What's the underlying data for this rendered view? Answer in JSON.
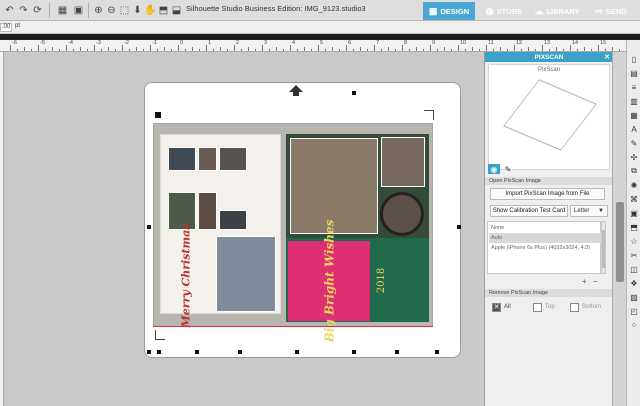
{
  "app": {
    "title": "Silhouette Studio Business Edition: IMG_9123.studio3"
  },
  "tabs": [
    {
      "label": "DESIGN",
      "icon": "grid-icon"
    },
    {
      "label": "STORE",
      "icon": "globe-icon"
    },
    {
      "label": "LIBRARY",
      "icon": "cloud-icon"
    },
    {
      "label": "SEND",
      "icon": "send-icon"
    }
  ],
  "subbar": {
    "value": ".00",
    "unit": "pt"
  },
  "ruler": {
    "labels": [
      "-6",
      "-5",
      "-4",
      "-3",
      "-2",
      "-1",
      "0",
      "1",
      "2",
      "3",
      "4",
      "5",
      "6",
      "7",
      "8",
      "9",
      "10",
      "11",
      "12",
      "13",
      "14",
      "15",
      "16"
    ]
  },
  "artwork": {
    "merry_text": "Merry Christmas",
    "big_text": "Big Bright Wishes",
    "year": "2018"
  },
  "panel": {
    "title": "PIXSCAN",
    "preview_label": "PixScan",
    "open_section": "Open PixScan Image",
    "import_button": "Import PixScan Image from File",
    "calibration_button": "Show Calibration Test Card",
    "paper_size": "Letter",
    "list_items": [
      {
        "label": "None",
        "selected": false
      },
      {
        "label": "Auto",
        "selected": true
      },
      {
        "label": "Apple (iPhone 6s Plus) (4032x3024, 4:3)",
        "selected": false
      }
    ],
    "plus": "+",
    "minus": "−",
    "remove_section": "Remove PixScan Image",
    "remove_options": [
      {
        "label": "All",
        "checked": true
      },
      {
        "label": "Top",
        "checked": false
      },
      {
        "label": "Bottom",
        "checked": false
      }
    ]
  },
  "colors": {
    "accent": "#3aa1c8",
    "design_tab": "#49a7d2",
    "pink": "#df2f74",
    "card_green": "#1f6a4d",
    "gold_text": "#e9d65a"
  }
}
